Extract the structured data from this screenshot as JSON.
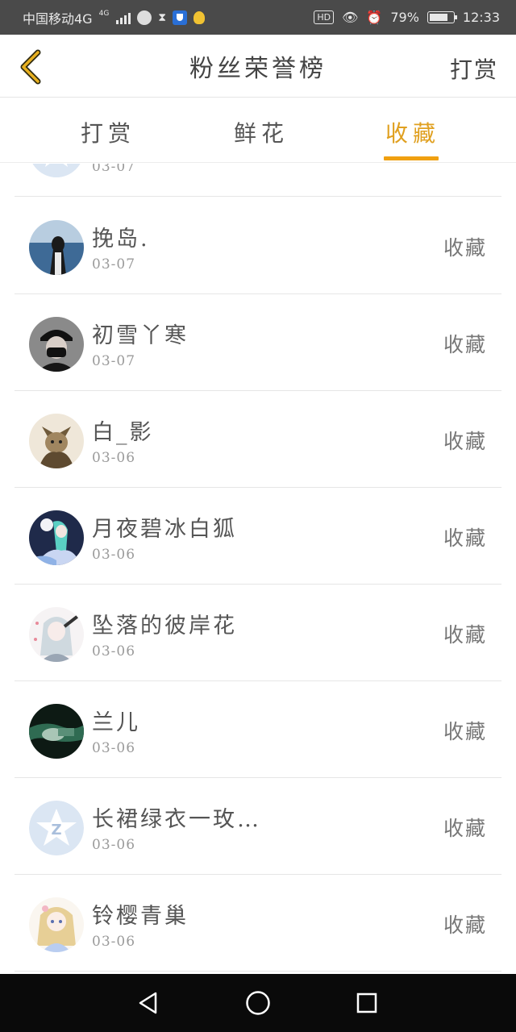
{
  "status_bar": {
    "carrier": "中国移动4G",
    "network_tag": "4G",
    "hd": "HD",
    "battery": "79%",
    "time": "12:33"
  },
  "header": {
    "title": "粉丝荣誉榜",
    "right_action": "打赏"
  },
  "tabs": [
    {
      "label": "打赏"
    },
    {
      "label": "鲜花"
    },
    {
      "label": "收藏"
    }
  ],
  "active_tab": "收藏",
  "accent_color": "#f0a010",
  "partial_row": {
    "date": "03-07"
  },
  "rows": [
    {
      "name": "挽岛.",
      "date": "03-07",
      "action": "收藏",
      "avatar": "person-sea"
    },
    {
      "name": "初雪丫寒",
      "date": "03-07",
      "action": "收藏",
      "avatar": "masked-person"
    },
    {
      "name": "白_影",
      "date": "03-06",
      "action": "收藏",
      "avatar": "cat-illustration"
    },
    {
      "name": "月夜碧冰白狐",
      "date": "03-06",
      "action": "收藏",
      "avatar": "anime-moonlight"
    },
    {
      "name": "坠落的彼岸花",
      "date": "03-06",
      "action": "收藏",
      "avatar": "anime-girl-silver"
    },
    {
      "name": "兰儿",
      "date": "03-06",
      "action": "收藏",
      "avatar": "dark-green-photo"
    },
    {
      "name": "长裙绿衣一玫…",
      "date": "03-06",
      "action": "收藏",
      "avatar": "default-qq-avatar"
    },
    {
      "name": "铃樱青巢",
      "date": "03-06",
      "action": "收藏",
      "avatar": "anime-girl-blonde"
    }
  ]
}
